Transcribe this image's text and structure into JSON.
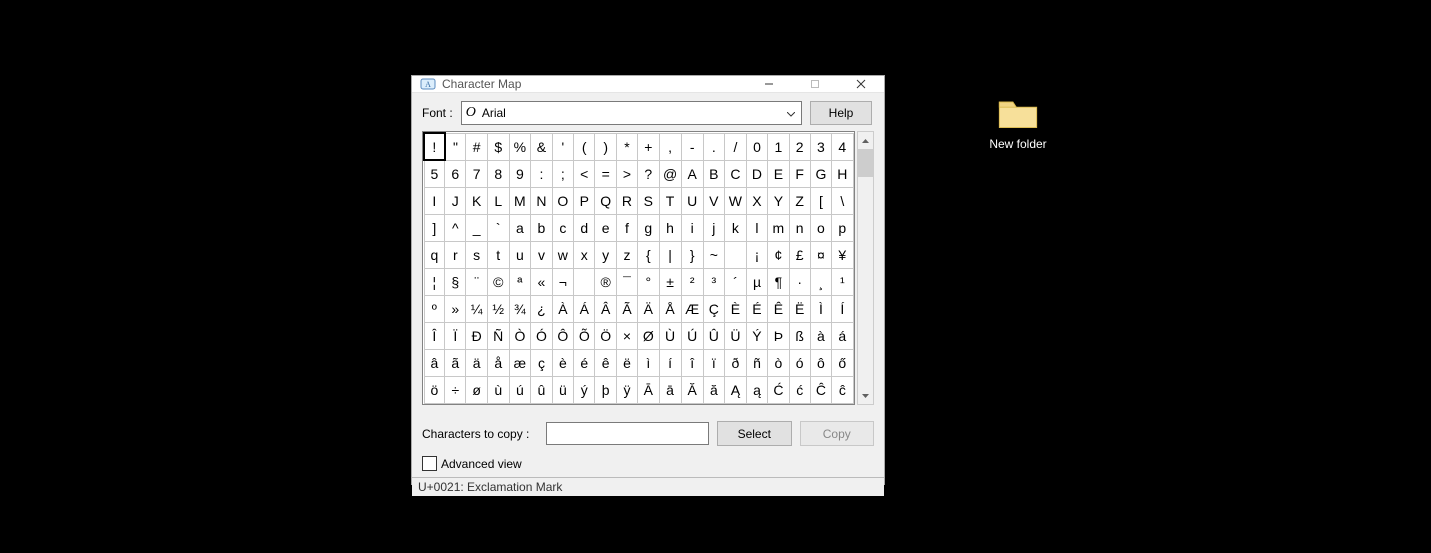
{
  "desktop": {
    "folder_label": "New folder"
  },
  "window": {
    "title": "Character Map",
    "minimize": "minimize",
    "maximize": "maximize",
    "close": "close"
  },
  "toolbar": {
    "font_label": "Font :",
    "font_name": "Arial",
    "help_label": "Help"
  },
  "grid": {
    "selected_index": 0,
    "rows": [
      [
        "!",
        "\"",
        "#",
        "$",
        "%",
        "&",
        "'",
        "(",
        ")",
        "*",
        "+",
        ",",
        "-",
        ".",
        "/",
        "0",
        "1",
        "2",
        "3",
        "4"
      ],
      [
        "5",
        "6",
        "7",
        "8",
        "9",
        ":",
        ";",
        "<",
        "=",
        ">",
        "?",
        "@",
        "A",
        "B",
        "C",
        "D",
        "E",
        "F",
        "G",
        "H"
      ],
      [
        "I",
        "J",
        "K",
        "L",
        "M",
        "N",
        "O",
        "P",
        "Q",
        "R",
        "S",
        "T",
        "U",
        "V",
        "W",
        "X",
        "Y",
        "Z",
        "[",
        "\\"
      ],
      [
        "]",
        "^",
        "_",
        "`",
        "a",
        "b",
        "c",
        "d",
        "e",
        "f",
        "g",
        "h",
        "i",
        "j",
        "k",
        "l",
        "m",
        "n",
        "o",
        "p"
      ],
      [
        "q",
        "r",
        "s",
        "t",
        "u",
        "v",
        "w",
        "x",
        "y",
        "z",
        "{",
        "|",
        "}",
        "~",
        "",
        "¡",
        "¢",
        "£",
        "¤",
        "¥"
      ],
      [
        "¦",
        "§",
        "¨",
        "©",
        "ª",
        "«",
        "¬",
        "­",
        "®",
        "¯",
        "°",
        "±",
        "²",
        "³",
        "´",
        "µ",
        "¶",
        "·",
        "¸",
        "¹"
      ],
      [
        "º",
        "»",
        "¼",
        "½",
        "¾",
        "¿",
        "À",
        "Á",
        "Â",
        "Ã",
        "Ä",
        "Å",
        "Æ",
        "Ç",
        "È",
        "É",
        "Ê",
        "Ë",
        "Ì",
        "Í"
      ],
      [
        "Î",
        "Ï",
        "Ð",
        "Ñ",
        "Ò",
        "Ó",
        "Ô",
        "Õ",
        "Ö",
        "×",
        "Ø",
        "Ù",
        "Ú",
        "Û",
        "Ü",
        "Ý",
        "Þ",
        "ß",
        "à",
        "á"
      ],
      [
        "â",
        "ã",
        "ä",
        "å",
        "æ",
        "ç",
        "è",
        "é",
        "ê",
        "ë",
        "ì",
        "í",
        "î",
        "ï",
        "ð",
        "ñ",
        "ò",
        "ó",
        "ô",
        "ő"
      ],
      [
        "ö",
        "÷",
        "ø",
        "ù",
        "ú",
        "û",
        "ü",
        "ý",
        "þ",
        "ÿ",
        "Ā",
        "ā",
        "Ă",
        "ă",
        "Ą",
        "ą",
        "Ć",
        "ć",
        "Ĉ",
        "ĉ"
      ]
    ]
  },
  "copy": {
    "label": "Characters to copy :",
    "value": "",
    "select_label": "Select",
    "copy_label": "Copy"
  },
  "advanced": {
    "label": "Advanced view",
    "checked": false
  },
  "status": {
    "text": "U+0021: Exclamation Mark"
  }
}
